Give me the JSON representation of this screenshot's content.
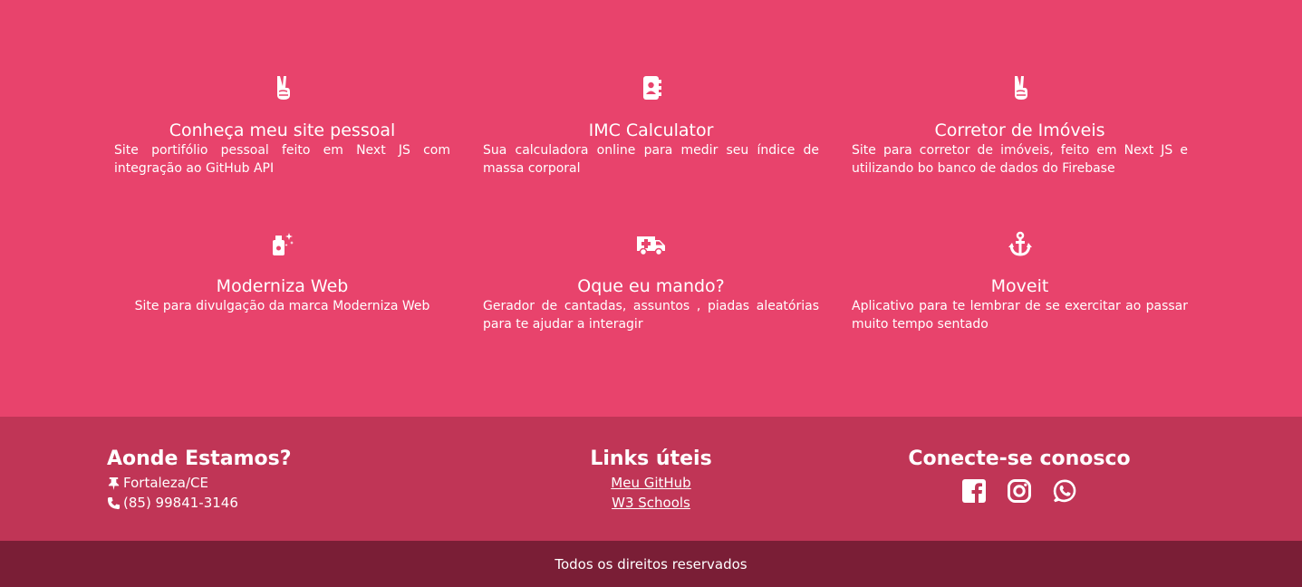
{
  "colors": {
    "projects_bg": "#e8436c",
    "footer_bg": "#c03556",
    "copyright_bg": "#7a1e36",
    "text": "#ffffff"
  },
  "projects": [
    {
      "icon": "peace-hand-icon",
      "title": "Conheça meu site pessoal",
      "description": "Site portifólio pessoal feito em Next JS com integração ao GitHub API"
    },
    {
      "icon": "address-book-icon",
      "title": "IMC Calculator",
      "description": "Sua calculadora online para medir seu índice de massa corporal"
    },
    {
      "icon": "peace-hand-icon",
      "title": "Corretor de Imóveis",
      "description": "Site para corretor de imóveis, feito em Next JS e utilizando bo banco de dados do Firebase"
    },
    {
      "icon": "spray-bottle-icon",
      "title": "Moderniza Web",
      "description": "Site para divulgação da marca Moderniza Web"
    },
    {
      "icon": "ambulance-icon",
      "title": "Oque eu mando?",
      "description": "Gerador de cantadas, assuntos , piadas aleatórias para te ajudar a interagir"
    },
    {
      "icon": "anchor-icon",
      "title": "Moveit",
      "description": "Aplicativo para te lembrar de se exercitar ao passar muito tempo sentado"
    }
  ],
  "footer": {
    "where": {
      "title": "Aonde Estamos?",
      "location": "Fortaleza/CE",
      "phone": "(85) 99841-3146",
      "location_icon": "thumbtack-icon",
      "phone_icon": "phone-icon"
    },
    "links": {
      "title": "Links úteis",
      "items": [
        "Meu GitHub",
        "W3 Schools"
      ]
    },
    "social": {
      "title": "Conecte-se conosco",
      "icons": [
        "facebook-icon",
        "instagram-icon",
        "whatsapp-icon"
      ]
    }
  },
  "copyright": "Todos os direitos reservados"
}
